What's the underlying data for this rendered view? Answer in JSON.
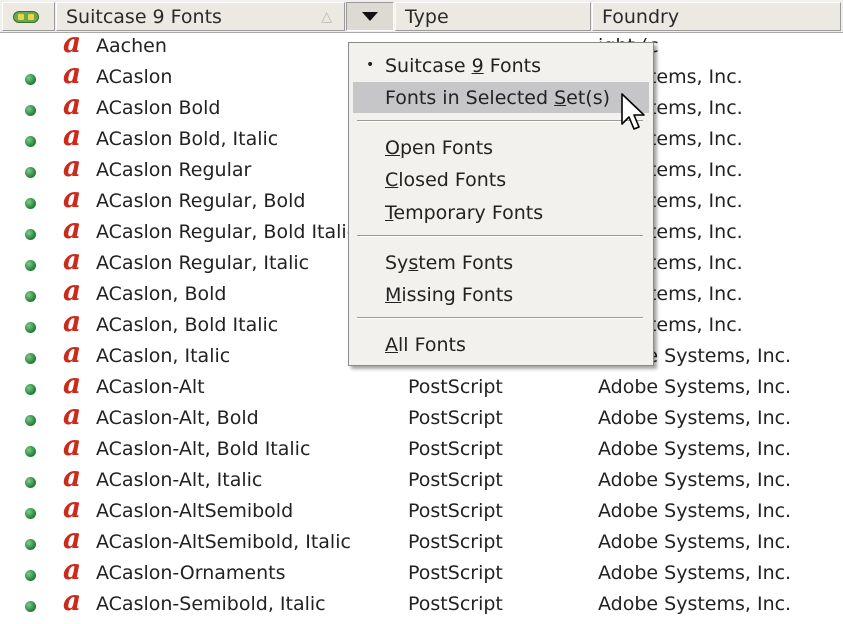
{
  "header": {
    "name_label": "Suitcase 9 Fonts",
    "type_label": "Type",
    "foundry_label": "Foundry",
    "sort_icon": "sort-ascending-icon",
    "dropdown_icon": "chevron-down-icon"
  },
  "rows": [
    {
      "name": "Aachen",
      "type": "",
      "foundry": "ight (c",
      "active": false
    },
    {
      "name": "ACaslon",
      "type": "",
      "foundry": "e Systems, Inc.",
      "active": true
    },
    {
      "name": "ACaslon Bold",
      "type": "",
      "foundry": "e Systems, Inc.",
      "active": true
    },
    {
      "name": "ACaslon Bold, Italic",
      "type": "",
      "foundry": "e Systems, Inc.",
      "active": true
    },
    {
      "name": "ACaslon Regular",
      "type": "",
      "foundry": "e Systems, Inc.",
      "active": true
    },
    {
      "name": "ACaslon Regular, Bold",
      "type": "",
      "foundry": "e Systems, Inc.",
      "active": true
    },
    {
      "name": "ACaslon Regular, Bold Italic",
      "type": "",
      "foundry": "e Systems, Inc.",
      "active": true
    },
    {
      "name": "ACaslon Regular, Italic",
      "type": "",
      "foundry": "e Systems, Inc.",
      "active": true
    },
    {
      "name": "ACaslon, Bold",
      "type": "",
      "foundry": "e Systems, Inc.",
      "active": true
    },
    {
      "name": "ACaslon, Bold Italic",
      "type": "",
      "foundry": "e Systems, Inc.",
      "active": true
    },
    {
      "name": "ACaslon, Italic",
      "type": "PostScript",
      "foundry": "Adobe Systems, Inc.",
      "active": true
    },
    {
      "name": "ACaslon-Alt",
      "type": "PostScript",
      "foundry": "Adobe Systems, Inc.",
      "active": true
    },
    {
      "name": "ACaslon-Alt, Bold",
      "type": "PostScript",
      "foundry": "Adobe Systems, Inc.",
      "active": true
    },
    {
      "name": "ACaslon-Alt, Bold Italic",
      "type": "PostScript",
      "foundry": "Adobe Systems, Inc.",
      "active": true
    },
    {
      "name": "ACaslon-Alt, Italic",
      "type": "PostScript",
      "foundry": "Adobe Systems, Inc.",
      "active": true
    },
    {
      "name": "ACaslon-AltSemibold",
      "type": "PostScript",
      "foundry": "Adobe Systems, Inc.",
      "active": true
    },
    {
      "name": "ACaslon-AltSemibold, Italic",
      "type": "PostScript",
      "foundry": "Adobe Systems, Inc.",
      "active": true
    },
    {
      "name": "ACaslon-Ornaments",
      "type": "PostScript",
      "foundry": "Adobe Systems, Inc.",
      "active": true
    },
    {
      "name": "ACaslon-Semibold, Italic",
      "type": "PostScript",
      "foundry": "Adobe Systems, Inc.",
      "active": true
    }
  ],
  "font_icon_glyph": "a",
  "menu": {
    "items": [
      {
        "pre": "Suitcase ",
        "u": "9",
        "post": " Fonts",
        "checked": true
      },
      {
        "pre": "Fonts in Selected ",
        "u": "S",
        "post": "et(s)",
        "highlighted": true
      },
      {
        "pre": "",
        "u": "O",
        "post": "pen Fonts"
      },
      {
        "pre": "",
        "u": "C",
        "post": "losed Fonts"
      },
      {
        "pre": "",
        "u": "T",
        "post": "emporary Fonts"
      },
      {
        "pre": "Sy",
        "u": "s",
        "post": "tem Fonts"
      },
      {
        "pre": "",
        "u": "M",
        "post": "issing Fonts"
      },
      {
        "pre": "",
        "u": "A",
        "post": "ll Fonts"
      }
    ],
    "bullet": "•"
  },
  "colors": {
    "active_dot": "#2e8b40",
    "font_icon": "#cc2a1a",
    "menu_highlight": "#c6c5c8"
  }
}
